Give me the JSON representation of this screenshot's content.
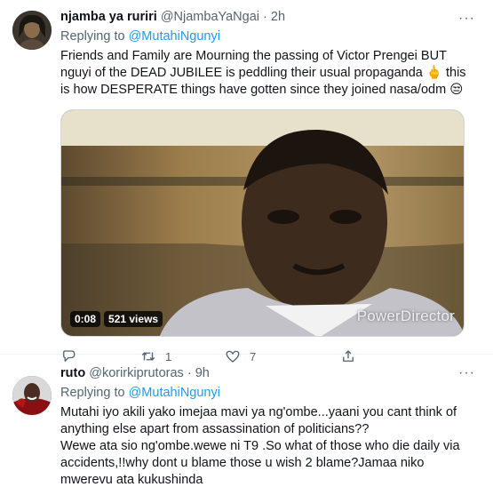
{
  "tweets": [
    {
      "name": "njamba ya ruriri",
      "handle": "@NjambaYaNgai",
      "dot": "·",
      "time": "2h",
      "replying_label": "Replying to",
      "replying_to": "@MutahiNgunyi",
      "text_lines": [
        "Friends and Family are Mourning the passing of Victor Prengei BUT nguyi of the DEAD JUBILEE is peddling their usual propaganda 🖕 this is how DESPERATE things have gotten since they joined nasa/odm 😒"
      ],
      "video": {
        "duration": "0:08",
        "views": "521 views",
        "watermark": "PowerDirector"
      },
      "actions": {
        "reply_count": "",
        "retweet_count": "1",
        "like_count": "7"
      }
    },
    {
      "name": "ruto",
      "handle": "@korirkiprutoras",
      "dot": "·",
      "time": "9h",
      "replying_label": "Replying to",
      "replying_to": "@MutahiNgunyi",
      "text_lines": [
        "Mutahi iyo akili yako imejaa mavi ya ng'ombe...yaani you cant think of anything else apart from assassination  of politicians??",
        "Wewe ata sio ng'ombe.wewe ni T9 .So what of those who die daily via accidents,!!why dont u blame those u wish 2 blame?Jamaa niko mwerevu ata kukushinda"
      ]
    }
  ],
  "icons": {
    "more": "more-icon",
    "reply": "reply-icon",
    "retweet": "retweet-icon",
    "like": "like-icon",
    "share": "share-icon"
  },
  "colors": {
    "link": "#1d9bf0",
    "muted": "#536471"
  }
}
